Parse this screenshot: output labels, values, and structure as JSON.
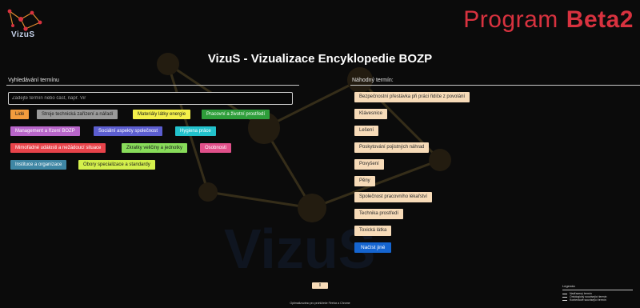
{
  "header": {
    "logo_text": "VizuS",
    "program_label": "Program",
    "program_version": "Beta2",
    "title": "VizuS - Vizualizace Encyklopedie BOZP"
  },
  "search": {
    "label": "Vyhledávání termínu",
    "placeholder": "Zadejte termín nebo část, např. Vir"
  },
  "categories": [
    {
      "label": "Lidé",
      "color": "#f39c3d"
    },
    {
      "label": "Stroje technická zařízení a nářadí",
      "color": "#9a9a9a"
    },
    {
      "label": "Materiály látky energie",
      "color": "#f4f04a"
    },
    {
      "label": "Pracovní a životní prostředí",
      "color": "#2e9e3a"
    },
    {
      "label": "Management a řízení BOZP",
      "color": "#b865c9"
    },
    {
      "label": "Sociální aspekty společnost",
      "color": "#5c5ed0"
    },
    {
      "label": "Hygiena práce",
      "color": "#22c2cc"
    },
    {
      "label": "Mimořádné události a nežádoucí situace",
      "color": "#e8434a"
    },
    {
      "label": "Zkratky veličiny a jednotky",
      "color": "#88dc5a"
    },
    {
      "label": "Osobnosti",
      "color": "#e0508a"
    },
    {
      "label": "Instituce a organizace",
      "color": "#3f87a5"
    },
    {
      "label": "Obory specializace a standardy",
      "color": "#d4f04c"
    }
  ],
  "random": {
    "label": "Náhodný termín:",
    "terms": [
      "Bezpečnostní přestávka při práci řidiče z povolání",
      "Klávesnice",
      "Lešení",
      "Poskytování pojistných náhrad",
      "Povyšení",
      "Pěny",
      "Společnost pracovního lékařství",
      "Technika prostředí",
      "Toxická látka"
    ],
    "reload_label": "Načíst jiné"
  },
  "pagination": {
    "button_label": "II"
  },
  "footer": {
    "text": "Optimalizováno pro prohlížeče Firefox a Chrome"
  },
  "legend": {
    "title": "Legenda",
    "items": [
      "Nadřazený termín",
      "Ontologický související termín",
      "Kontextově související termín"
    ]
  }
}
